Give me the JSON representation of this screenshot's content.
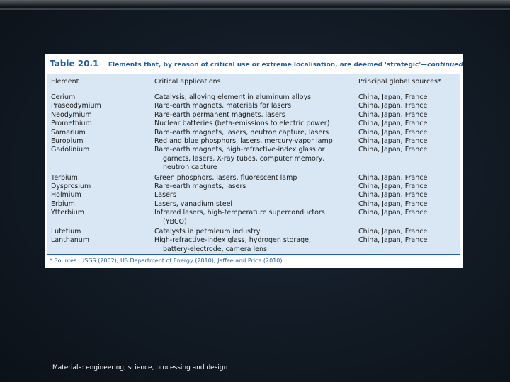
{
  "table": {
    "number": "Table 20.1",
    "caption_main": "Elements that, by reason of critical use or extreme localisation, are deemed 'strategic'",
    "caption_suffix": "—continued",
    "headers": [
      "Element",
      "Critical applications",
      "Principal global sources*"
    ],
    "rows": [
      {
        "element": "Cerium",
        "apps": [
          "Catalysis, alloying element in aluminum alloys"
        ],
        "sources": "China, Japan, France"
      },
      {
        "element": "Praseodymium",
        "apps": [
          "Rare-earth magnets, materials for lasers"
        ],
        "sources": "China, Japan, France"
      },
      {
        "element": "Neodymium",
        "apps": [
          "Rare-earth permanent magnets, lasers"
        ],
        "sources": "China, Japan, France"
      },
      {
        "element": "Promethium",
        "apps": [
          "Nuclear batteries (beta-emissions to electric power)"
        ],
        "sources": "China, Japan, France"
      },
      {
        "element": "Samarium",
        "apps": [
          "Rare-earth magnets, lasers, neutron capture, lasers"
        ],
        "sources": "China, Japan, France"
      },
      {
        "element": "Europium",
        "apps": [
          "Red and blue phosphors, lasers, mercury-vapor lamp"
        ],
        "sources": "China, Japan, France"
      },
      {
        "element": "Gadolinium",
        "apps": [
          "Rare-earth magnets, high-refractive-index glass or",
          "garnets, lasers, X-ray tubes, computer memory,",
          "neutron capture"
        ],
        "sources": "China, Japan, France"
      },
      {
        "element": "Terbium",
        "apps": [
          "Green phosphors, lasers, fluorescent lamp"
        ],
        "sources": "China, Japan, France"
      },
      {
        "element": "Dysprosium",
        "apps": [
          "Rare-earth magnets, lasers"
        ],
        "sources": "China, Japan, France"
      },
      {
        "element": "Holmium",
        "apps": [
          "Lasers"
        ],
        "sources": "China, Japan, France"
      },
      {
        "element": "Erbium",
        "apps": [
          "Lasers, vanadium steel"
        ],
        "sources": "China, Japan, France"
      },
      {
        "element": "Ytterbium",
        "apps": [
          "Infrared lasers, high-temperature superconductors",
          "(YBCO)"
        ],
        "sources": "China, Japan, France"
      },
      {
        "element": "Lutetium",
        "apps": [
          "Catalysts in petroleum industry"
        ],
        "sources": "China, Japan, France"
      },
      {
        "element": "Lanthanum",
        "apps": [
          "High-refractive-index glass, hydrogen storage,",
          "battery-electrode, camera lens"
        ],
        "sources": "China, Japan, France"
      }
    ],
    "footnote": "* Sources: USGS (2002); US Department of Energy (2010); Jaffee and Price (2010)."
  },
  "footer": "Materials: engineering, science, processing and design"
}
